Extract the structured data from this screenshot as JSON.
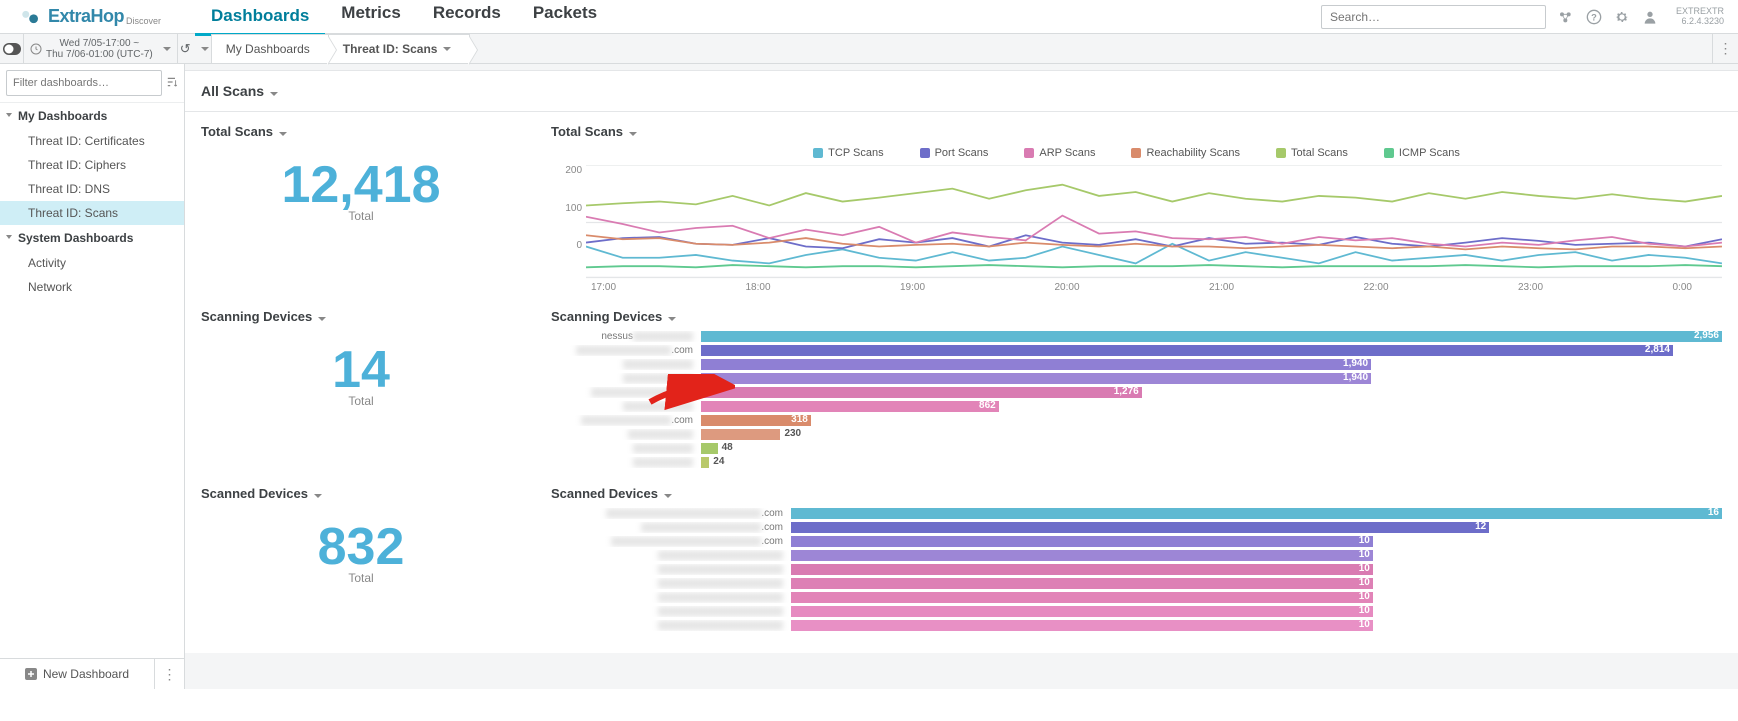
{
  "brand": {
    "name": "ExtraHop",
    "sub": "Discover"
  },
  "nav": {
    "items": [
      "Dashboards",
      "Metrics",
      "Records",
      "Packets"
    ],
    "active": "Dashboards"
  },
  "search": {
    "placeholder": "Search…"
  },
  "user": {
    "name": "EXTREXTR",
    "version": "6.2.4.3230"
  },
  "time": {
    "line1": "Wed 7/05-17:00 ~",
    "line2": "Thu 7/06-01:00 (UTC-7)"
  },
  "breadcrumb": {
    "root": "My Dashboards",
    "leaf": "Threat ID: Scans"
  },
  "filter": {
    "placeholder": "Filter dashboards…"
  },
  "sidebar": {
    "grp1": "My Dashboards",
    "items1": [
      "Threat ID: Certificates",
      "Threat ID: Ciphers",
      "Threat ID: DNS",
      "Threat ID: Scans"
    ],
    "selected": "Threat ID: Scans",
    "grp2": "System Dashboards",
    "items2": [
      "Activity",
      "Network"
    ],
    "newdash": "New Dashboard"
  },
  "region": {
    "title": "All Scans"
  },
  "widgets": {
    "totalScans": {
      "title": "Total Scans",
      "value": "12,418",
      "label": "Total"
    },
    "totalScansChart": {
      "title": "Total Scans",
      "legend": [
        {
          "name": "TCP Scans",
          "color": "#5fb9d2"
        },
        {
          "name": "Port Scans",
          "color": "#6d6dc9"
        },
        {
          "name": "ARP Scans",
          "color": "#d97bb2"
        },
        {
          "name": "Reachability Scans",
          "color": "#d98b6b"
        },
        {
          "name": "Total Scans",
          "color": "#a6c96a"
        },
        {
          "name": "ICMP Scans",
          "color": "#5fc98f"
        }
      ],
      "yticks": [
        "200",
        "100",
        "0"
      ],
      "xticks": [
        "17:00",
        "18:00",
        "19:00",
        "20:00",
        "21:00",
        "22:00",
        "23:00",
        "0:00"
      ]
    },
    "scanningDevices": {
      "title": "Scanning Devices",
      "value": "14",
      "label": "Total"
    },
    "scanningDevicesBars": {
      "title": "Scanning Devices",
      "max": 2956,
      "bars": [
        {
          "label_prefix": "nessus",
          "label_blur": "xxxxxxxxxxxx",
          "suffix": "",
          "value": 2956,
          "color": "#5fb9d2"
        },
        {
          "label_prefix": "",
          "label_blur": "xxxxxxxxxxxxxxxxxxx",
          "suffix": ".com",
          "value": 2814,
          "color": "#6d6dc9"
        },
        {
          "label_prefix": "",
          "label_blur": "xxxxxxxxxxxxxx",
          "suffix": "",
          "value": 1940,
          "color": "#8f7fd4"
        },
        {
          "label_prefix": "",
          "label_blur": "xxxxxxxxxxxxxx",
          "suffix": "",
          "value": 1940,
          "color": "#9d86d6"
        },
        {
          "label_prefix": "",
          "label_blur": "xxxxxxxxxxxxxxxx",
          "suffix": ".com",
          "value": 1276,
          "color": "#d97bb2"
        },
        {
          "label_prefix": "",
          "label_blur": "xxxxxxxxxxxxxx",
          "suffix": "",
          "value": 862,
          "color": "#e284b8"
        },
        {
          "label_prefix": "",
          "label_blur": "xxxxxxxxxxxxxxxxxx",
          "suffix": ".com",
          "value": 318,
          "color": "#d98b6b"
        },
        {
          "label_prefix": "",
          "label_blur": "xxxxxxxxxxxxx",
          "suffix": "",
          "value": 230,
          "color": "#dd9a7f"
        },
        {
          "label_prefix": "",
          "label_blur": "xxxxxxxxxxxx",
          "suffix": "",
          "value": 48,
          "color": "#a6c96a"
        },
        {
          "label_prefix": "",
          "label_blur": "xxxxxxxxxxxx",
          "suffix": "",
          "value": 24,
          "color": "#b9c96a"
        }
      ]
    },
    "scannedDevices": {
      "title": "Scanned Devices",
      "value": "832",
      "label": "Total"
    },
    "scannedDevicesBars": {
      "title": "Scanned Devices",
      "max": 16,
      "bars": [
        {
          "label_prefix": "",
          "label_blur": "xxxxxxxxxxxxxxxxxxxxxxxxxxxxxxx",
          "suffix": ".com",
          "value": 16,
          "color": "#5fb9d2"
        },
        {
          "label_prefix": "",
          "label_blur": "xxxxxxxxxxxxxxxxxxxxxxxx",
          "suffix": ".com",
          "value": 12,
          "color": "#6d6dc9"
        },
        {
          "label_prefix": "",
          "label_blur": "xxxxxxxxxxxxxxxxxxxxxxxxxxxxxx",
          "suffix": ".com",
          "value": 10,
          "color": "#8f7fd4"
        },
        {
          "label_prefix": "",
          "label_blur": "xxxxxxxxxxxxxxxxxxxxxxxxx",
          "suffix": "",
          "value": 10,
          "color": "#9d86d6"
        },
        {
          "label_prefix": "",
          "label_blur": "xxxxxxxxxxxxxxxxxxxxxxxxx",
          "suffix": "",
          "value": 10,
          "color": "#d97bb2"
        },
        {
          "label_prefix": "",
          "label_blur": "xxxxxxxxxxxxxxxxxxxxxxxxx",
          "suffix": "",
          "value": 10,
          "color": "#dd80b5"
        },
        {
          "label_prefix": "",
          "label_blur": "xxxxxxxxxxxxxxxxxxxxxxxxx",
          "suffix": "",
          "value": 10,
          "color": "#e284b8"
        },
        {
          "label_prefix": "",
          "label_blur": "xxxxxxxxxxxxxxxxxxxxxxxxx",
          "suffix": "",
          "value": 10,
          "color": "#e68ac0"
        },
        {
          "label_prefix": "",
          "label_blur": "xxxxxxxxxxxxxxxxxxxxxxxxx",
          "suffix": "",
          "value": 10,
          "color": "#e890c5"
        }
      ]
    }
  },
  "chart_data": {
    "type": "line",
    "title": "Total Scans",
    "xlabel": "",
    "ylabel": "",
    "ylim": [
      0,
      200
    ],
    "xticks": [
      "17:00",
      "18:00",
      "19:00",
      "20:00",
      "21:00",
      "22:00",
      "23:00",
      "0:00"
    ],
    "series": [
      {
        "name": "TCP Scans",
        "color": "#5fb9d2",
        "values": [
          55,
          35,
          35,
          40,
          30,
          25,
          40,
          50,
          35,
          30,
          45,
          30,
          35,
          55,
          40,
          25,
          60,
          30,
          45,
          35,
          25,
          45,
          30,
          35,
          40,
          30,
          40,
          45,
          30,
          40,
          35,
          25
        ]
      },
      {
        "name": "Port Scans",
        "color": "#6d6dc9",
        "values": [
          62,
          70,
          72,
          60,
          58,
          70,
          55,
          52,
          68,
          62,
          70,
          55,
          75,
          62,
          58,
          68,
          55,
          70,
          60,
          62,
          58,
          72,
          60,
          55,
          62,
          70,
          65,
          58,
          60,
          62,
          55,
          68
        ]
      },
      {
        "name": "ARP Scans",
        "color": "#d97bb2",
        "values": [
          108,
          95,
          80,
          88,
          92,
          70,
          85,
          75,
          90,
          62,
          80,
          72,
          66,
          110,
          78,
          82,
          70,
          68,
          72,
          60,
          72,
          66,
          70,
          60,
          55,
          62,
          58,
          66,
          72,
          60,
          55,
          62
        ]
      },
      {
        "name": "Reachability Scans",
        "color": "#d98b6b",
        "values": [
          75,
          68,
          70,
          60,
          58,
          62,
          70,
          60,
          55,
          58,
          60,
          55,
          62,
          58,
          55,
          60,
          55,
          55,
          52,
          55,
          58,
          55,
          52,
          55,
          50,
          55,
          52,
          50,
          55,
          55,
          52,
          55
        ]
      },
      {
        "name": "Total Scans",
        "color": "#a6c96a",
        "values": [
          128,
          132,
          135,
          130,
          145,
          128,
          150,
          135,
          142,
          150,
          158,
          140,
          155,
          165,
          145,
          152,
          135,
          150,
          140,
          135,
          145,
          142,
          135,
          150,
          140,
          152,
          145,
          140,
          148,
          140,
          135,
          145
        ]
      },
      {
        "name": "ICMP Scans",
        "color": "#5fc98f",
        "values": [
          18,
          20,
          20,
          18,
          22,
          20,
          18,
          20,
          20,
          18,
          20,
          22,
          20,
          18,
          20,
          20,
          20,
          22,
          20,
          18,
          20,
          20,
          20,
          20,
          22,
          20,
          18,
          20,
          20,
          20,
          22,
          20
        ]
      }
    ]
  }
}
